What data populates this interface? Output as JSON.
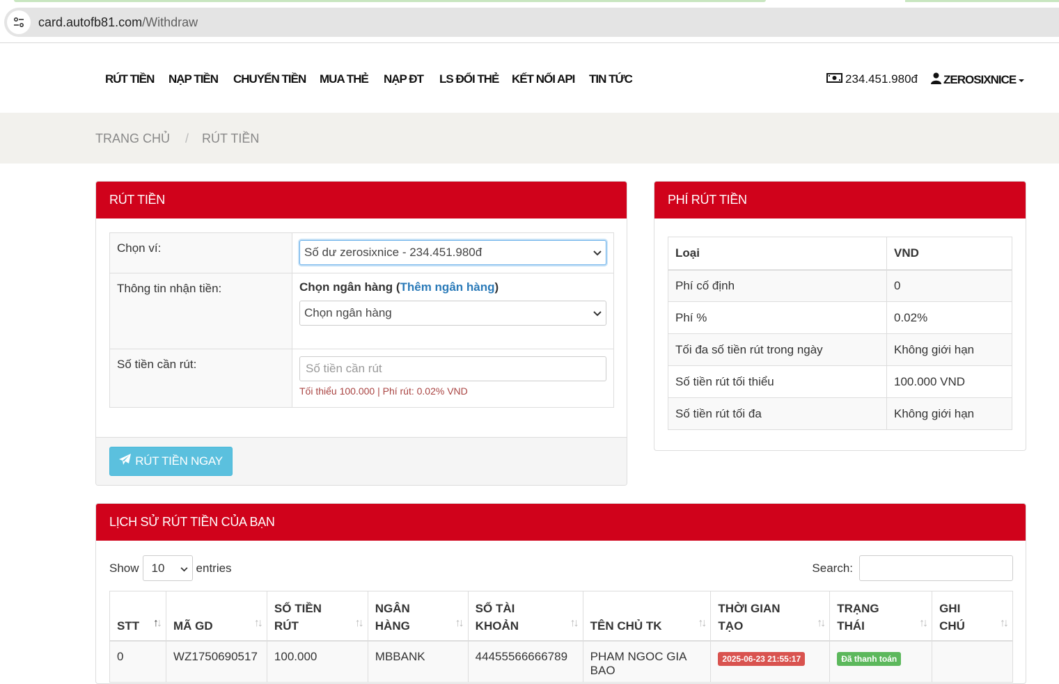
{
  "browser": {
    "url_host": "card.autofb81.com",
    "url_path": "/Withdraw"
  },
  "nav": {
    "items": [
      "RÚT TIỀN",
      "NẠP TIỀN",
      "CHUYỂN TIỀN",
      "MUA THẺ",
      "NẠP ĐT",
      "LS ĐỔI THẺ",
      "KẾT NỐI API",
      "TIN TỨC"
    ],
    "balance": "234.451.980đ",
    "username": "ZEROSIXNICE"
  },
  "breadcrumb": {
    "home": "TRANG CHỦ",
    "separator": "/",
    "current": "RÚT TIỀN"
  },
  "withdraw": {
    "title": "RÚT TIỀN",
    "wallet_label": "Chọn ví:",
    "wallet_value": "Số dư zerosixnice - 234.451.980đ",
    "receive_label": "Thông tin nhận tiền:",
    "bank_title_prefix": "Chọn ngân hàng (",
    "bank_add_link": "Thêm ngân hàng",
    "bank_title_suffix": ")",
    "bank_select": "Chọn ngân hàng",
    "amount_label": "Số tiền cần rút:",
    "amount_placeholder": "Số tiền cần rút",
    "amount_hint": "Tối thiểu 100.000 | Phí rút: 0.02% VND",
    "submit": "RÚT TIỀN NGAY"
  },
  "fees": {
    "title": "PHÍ RÚT TIỀN",
    "headers": [
      "Loại",
      "VND"
    ],
    "rows": [
      [
        "Phí cố định",
        "0"
      ],
      [
        "Phí %",
        "0.02%"
      ],
      [
        "Tối đa số tiền rút trong ngày",
        "Không giới hạn"
      ],
      [
        "Số tiền rút tối thiểu",
        "100.000 VND"
      ],
      [
        "Số tiền rút tối đa",
        "Không giới hạn"
      ]
    ]
  },
  "history": {
    "title": "LỊCH SỬ RÚT TIỀN CỦA BẠN",
    "show_label": "Show",
    "page_length": "10",
    "entries_label": "entries",
    "search_label": "Search:",
    "columns": [
      [
        "STT",
        ""
      ],
      [
        "MÃ GD",
        ""
      ],
      [
        "SỐ TIỀN",
        "RÚT"
      ],
      [
        "NGÂN",
        "HÀNG"
      ],
      [
        "SỐ TÀI",
        "KHOẢN"
      ],
      [
        "TÊN CHỦ TK",
        ""
      ],
      [
        "THỜI GIAN",
        "TẠO"
      ],
      [
        "TRẠNG",
        "THÁI"
      ],
      [
        "GHI",
        "CHÚ"
      ]
    ],
    "rows": [
      {
        "stt": "0",
        "code": "WZ1750690517",
        "amount": "100.000",
        "bank": "MBBANK",
        "account": "44455566666789",
        "owner": "PHAM NGOC GIA BAO",
        "created": "2025-06-23 21:55:17",
        "status": "Đã thanh toán",
        "note": ""
      }
    ]
  },
  "colors": {
    "header_red": "#d0021b",
    "button_info": "#5bc0de",
    "link_blue": "#2a7ab8",
    "hint_red": "#a94442",
    "badge_red": "#d9534f",
    "badge_green": "#5cb85c"
  }
}
